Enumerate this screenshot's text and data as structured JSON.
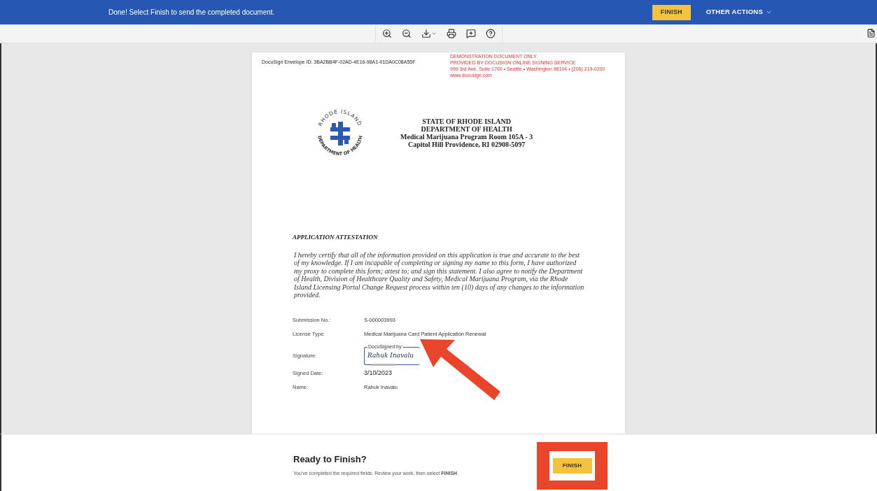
{
  "top_bar": {
    "message": "Done! Select Finish to send the completed document.",
    "finish_button": "FINISH",
    "other_actions": "OTHER ACTIONS"
  },
  "toolbar": {
    "tools": [
      {
        "kind": "zoom-in"
      },
      {
        "kind": "zoom-out"
      },
      {
        "kind": "download"
      },
      {
        "kind": "print"
      },
      {
        "kind": "comment"
      },
      {
        "kind": "help"
      }
    ]
  },
  "document": {
    "envelope_id": "DocuSign Envelope ID: 3BA2BB4F-02AD-4E16-98A1-01DA0C08A55F",
    "demo_notice": [
      "DEMONSTRATION DOCUMENT ONLY",
      "PROVIDED BY DOCUSIGN ONLINE SIGNING SERVICE",
      "999 3rd Ave, Suite 1700  • Seattle • Washington 98104 • (206) 219-0200",
      "www.docusign.com"
    ],
    "seal": {
      "top_text": "RHODE ISLAND",
      "bottom_text": "DEPARTMENT OF HEALTH"
    },
    "header": [
      "STATE OF RHODE ISLAND",
      "DEPARTMENT OF HEALTH",
      "Medical Marijuana Program Room 105A - 3",
      "Capitol Hill Providence, RI 02908-5097"
    ],
    "section_title": "APPLICATION ATTESTATION",
    "attestation": "I hereby certify that all of the information provided on this application is true and accurate to the best of my knowledge. If I am incapable of completing or signing my name to this form, I have authorized my proxy to complete this form; attest to; and sign this statement. I also agree to notify the Department of Health, Division of Healthcare Quality and Safety, Medical Marijuana Program, via the Rhode Island Licensing Portal Change Request process within ten (10) days of any changes to the information provided.",
    "fields": [
      {
        "kind": "text",
        "label": "Submission No.:",
        "value": "S-000003993"
      },
      {
        "kind": "text",
        "label": "License Type:",
        "value": "Medical Marijuana Card Patient Application Renewal"
      },
      {
        "kind": "signature",
        "label": "Signature:",
        "caption": "DocuSigned by:",
        "value": "Rahuk Inavalu"
      },
      {
        "kind": "text",
        "label": "Signed Date:",
        "value": "3/10/2023"
      },
      {
        "kind": "text",
        "label": "Name:",
        "value": "Rahuk Inavalu"
      }
    ]
  },
  "finish_panel": {
    "title": "Ready to Finish?",
    "message": "You've completed the required fields. Review your work, then select **FINISH**.",
    "finish_button": "FINISH"
  }
}
